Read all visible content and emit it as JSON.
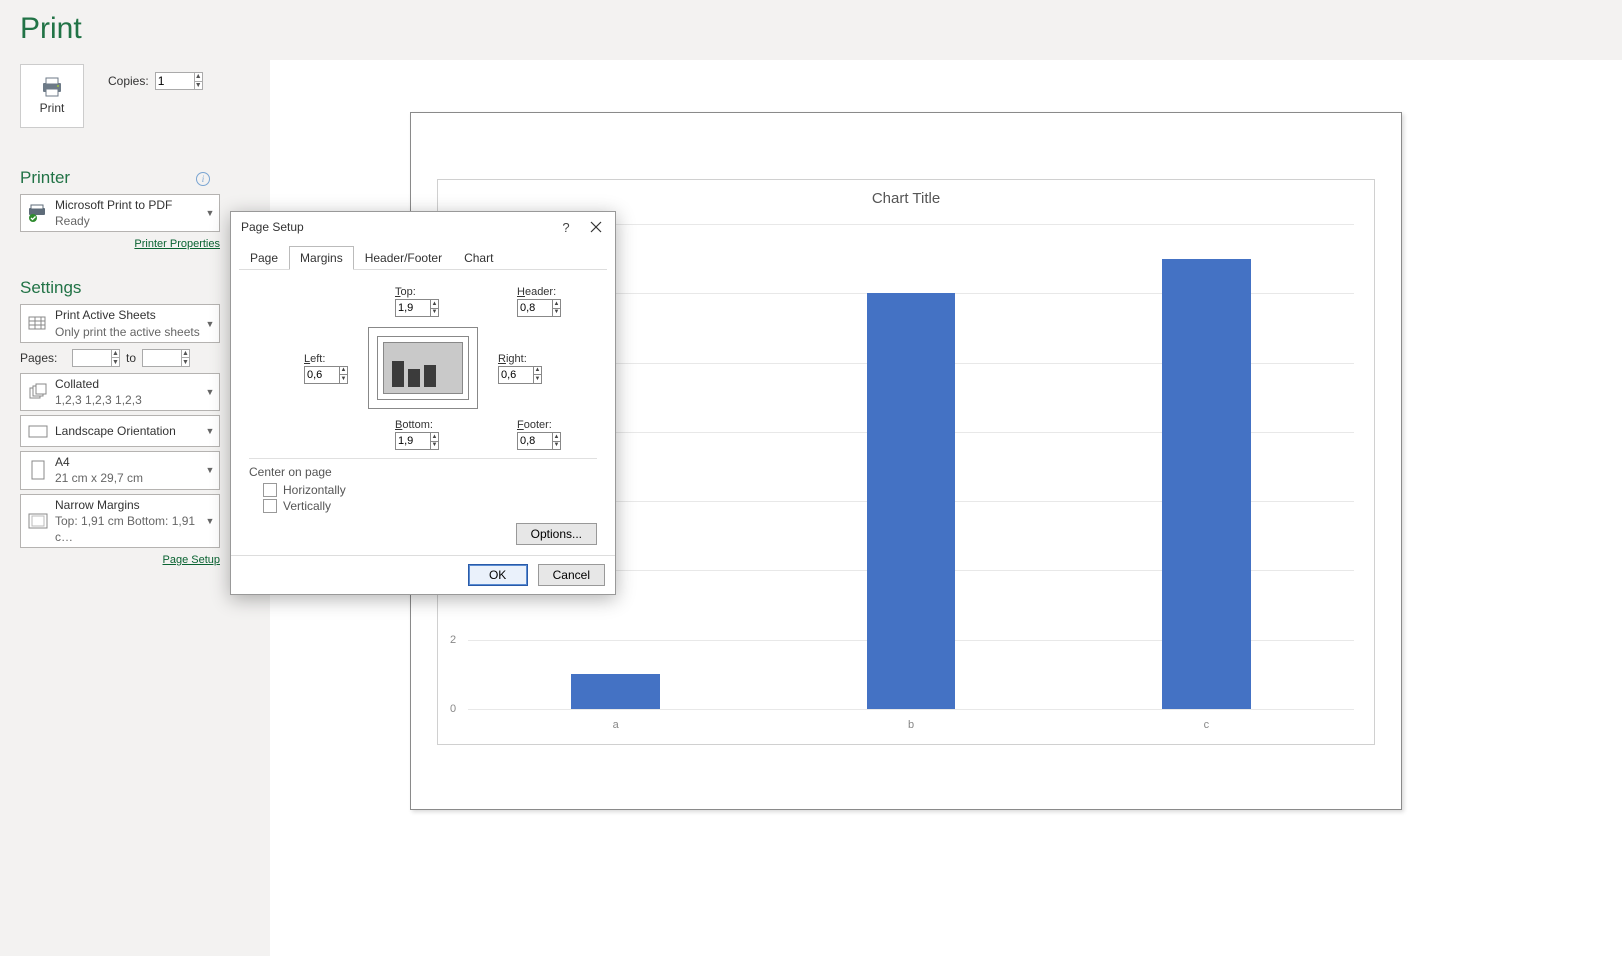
{
  "title": "Print",
  "print_button": "Print",
  "copies": {
    "label": "Copies:",
    "value": "1"
  },
  "printer": {
    "heading": "Printer",
    "name": "Microsoft Print to PDF",
    "status": "Ready",
    "properties_link": "Printer Properties"
  },
  "settings": {
    "heading": "Settings",
    "print_active": {
      "l1": "Print Active Sheets",
      "l2": "Only print the active sheets"
    },
    "pages": {
      "label": "Pages:",
      "to": "to",
      "from": "",
      "to_val": ""
    },
    "collated": {
      "l1": "Collated",
      "l2": "1,2,3    1,2,3    1,2,3"
    },
    "orientation": {
      "l1": "Landscape Orientation"
    },
    "paper": {
      "l1": "A4",
      "l2": "21 cm x 29,7 cm"
    },
    "margins": {
      "l1": "Narrow Margins",
      "l2": "Top: 1,91 cm Bottom: 1,91 c…"
    },
    "page_setup_link": "Page Setup"
  },
  "chart_data": {
    "type": "bar",
    "title": "Chart Title",
    "categories": [
      "a",
      "b",
      "c"
    ],
    "values": [
      1,
      12,
      13
    ],
    "ylim": [
      0,
      14
    ],
    "yticks": [
      0,
      2
    ],
    "bar_color": "#4472c4"
  },
  "dialog": {
    "title": "Page Setup",
    "tabs": {
      "page": "Page",
      "margins": "Margins",
      "hf": "Header/Footer",
      "chart": "Chart"
    },
    "active_tab": "margins",
    "margins": {
      "top": {
        "label": "Top:",
        "u": "T",
        "value": "1,9"
      },
      "header": {
        "label": "Header:",
        "u": "H",
        "value": "0,8"
      },
      "left": {
        "label": "Left:",
        "u": "L",
        "value": "0,6"
      },
      "right": {
        "label": "Right:",
        "u": "R",
        "value": "0,6"
      },
      "bottom": {
        "label": "Bottom:",
        "u": "B",
        "value": "1,9"
      },
      "footer": {
        "label": "Footer:",
        "u": "F",
        "value": "0,8"
      }
    },
    "center": {
      "heading": "Center on page",
      "h": "Horizontally",
      "v": "Vertically",
      "h_checked": false,
      "v_checked": false
    },
    "options_btn": "Options...",
    "ok": "OK",
    "cancel": "Cancel"
  }
}
